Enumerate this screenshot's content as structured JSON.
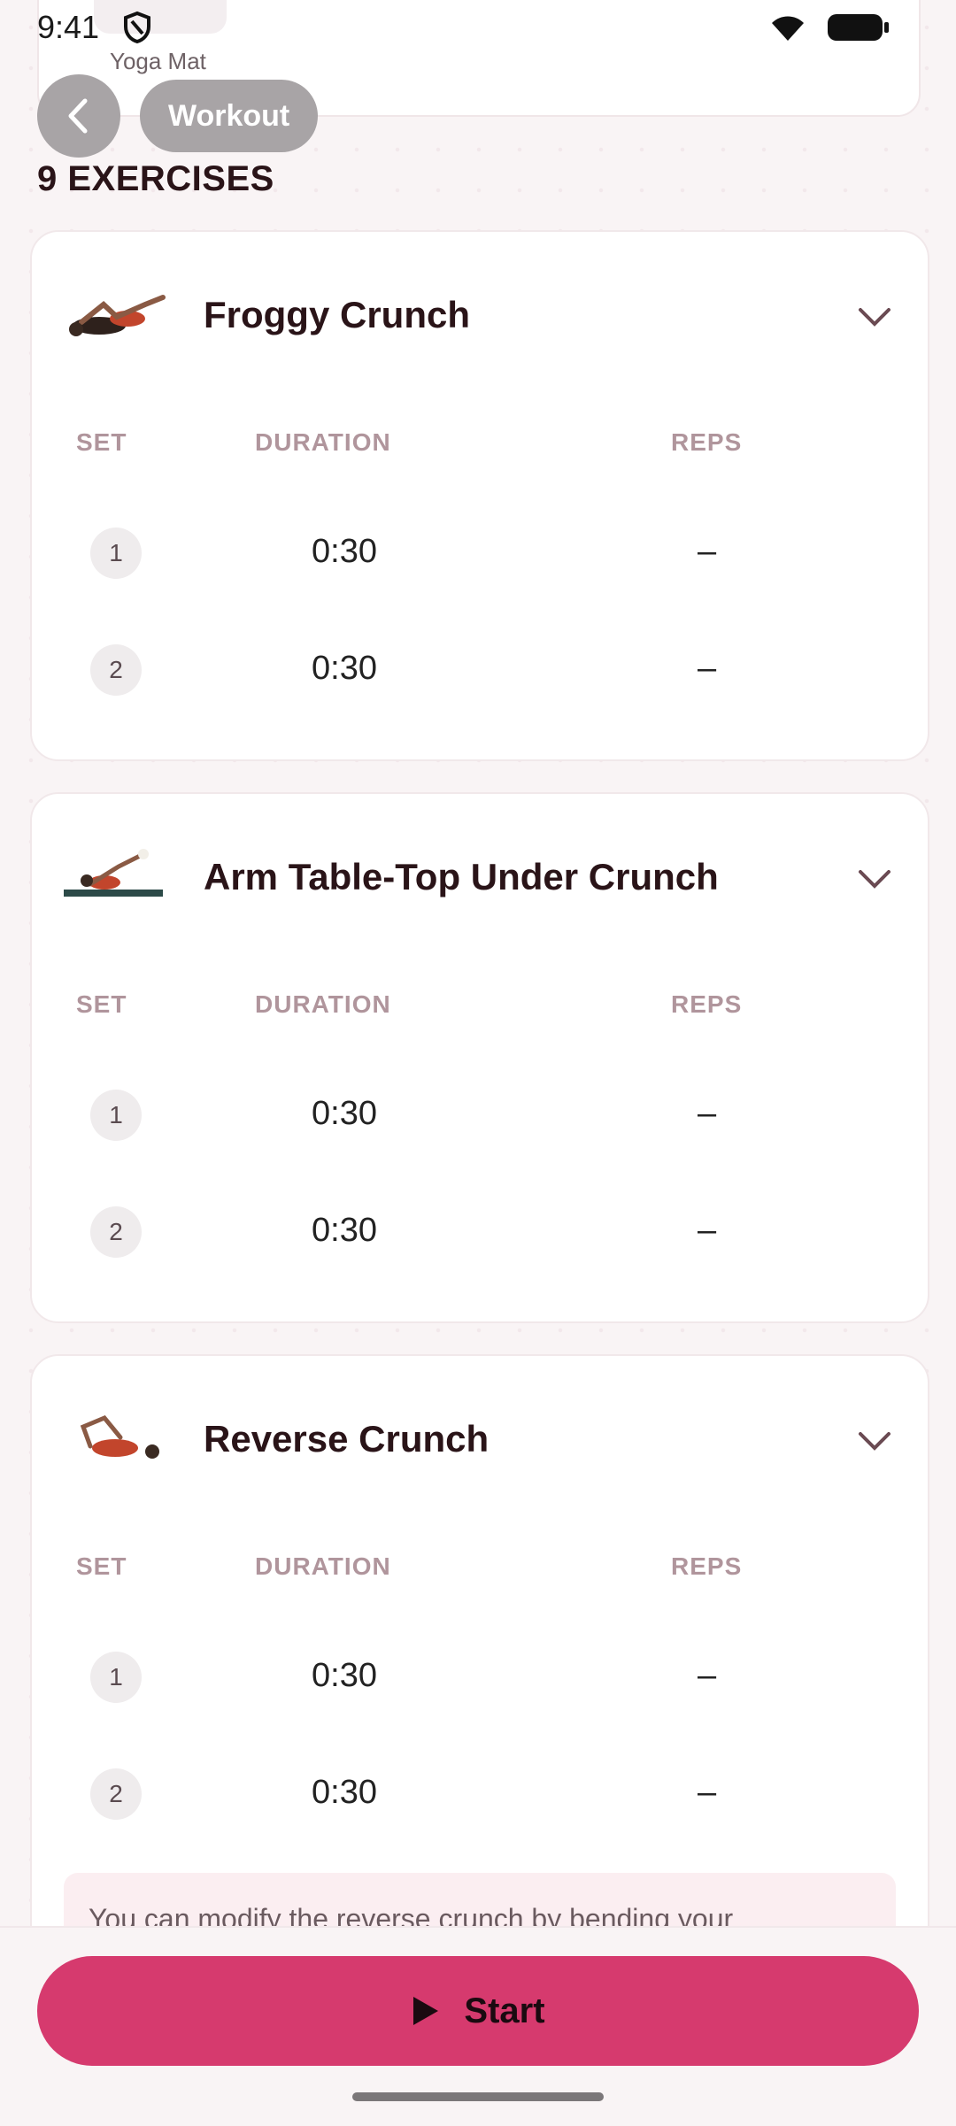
{
  "status_bar": {
    "time": "9:41"
  },
  "top_card": {
    "label": "Yoga Mat"
  },
  "header": {
    "workout_label": "Workout"
  },
  "section_title": "9 EXERCISES",
  "columns": {
    "set": "SET",
    "duration": "DURATION",
    "reps": "REPS"
  },
  "exercises": [
    {
      "name": "Froggy Crunch",
      "sets": [
        {
          "set": "1",
          "duration": "0:30",
          "reps": "–"
        },
        {
          "set": "2",
          "duration": "0:30",
          "reps": "–"
        }
      ]
    },
    {
      "name": "Arm Table-Top Under Crunch",
      "sets": [
        {
          "set": "1",
          "duration": "0:30",
          "reps": "–"
        },
        {
          "set": "2",
          "duration": "0:30",
          "reps": "–"
        }
      ]
    },
    {
      "name": "Reverse Crunch",
      "sets": [
        {
          "set": "1",
          "duration": "0:30",
          "reps": "–"
        },
        {
          "set": "2",
          "duration": "0:30",
          "reps": "–"
        }
      ],
      "tip": "You can modify the reverse crunch by bending your"
    }
  ],
  "start_button": {
    "label": "Start"
  },
  "colors": {
    "accent": "#d63a6e",
    "background": "#f9f4f5"
  }
}
